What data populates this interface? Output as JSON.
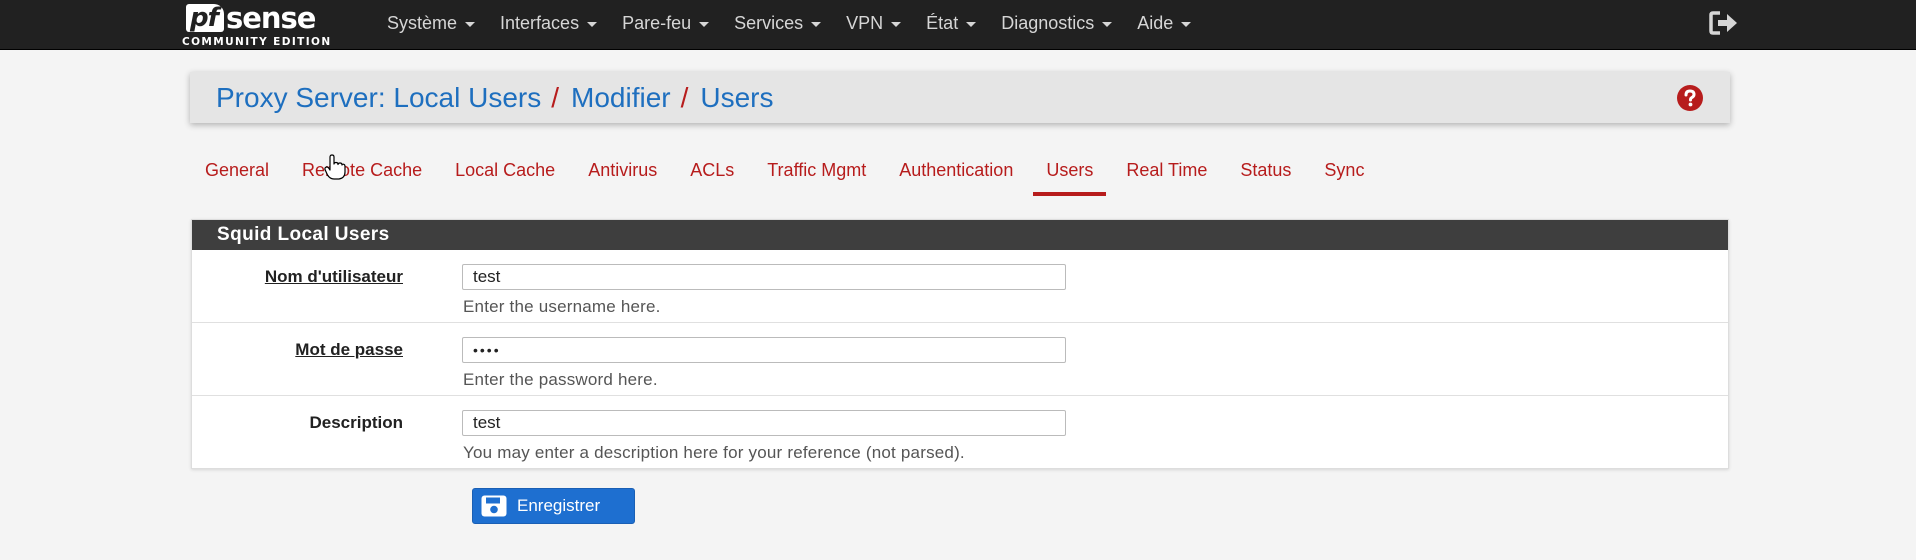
{
  "brand": {
    "logo_prefix": "pf",
    "logo_name": "sense",
    "edition": "COMMUNITY EDITION"
  },
  "nav": {
    "items": [
      {
        "label": "Système",
        "name": "nav-systeme"
      },
      {
        "label": "Interfaces",
        "name": "nav-interfaces"
      },
      {
        "label": "Pare-feu",
        "name": "nav-pare-feu"
      },
      {
        "label": "Services",
        "name": "nav-services"
      },
      {
        "label": "VPN",
        "name": "nav-vpn"
      },
      {
        "label": "État",
        "name": "nav-etat"
      },
      {
        "label": "Diagnostics",
        "name": "nav-diagnostics"
      },
      {
        "label": "Aide",
        "name": "nav-aide"
      }
    ],
    "logout_icon": "sign-out-icon"
  },
  "breadcrumb": {
    "items": [
      "Proxy Server: Local Users",
      "Modifier",
      "Users"
    ],
    "separator": "/",
    "help_icon": "question-circle-icon"
  },
  "tabs": {
    "items": [
      "General",
      "Remote Cache",
      "Local Cache",
      "Antivirus",
      "ACLs",
      "Traffic Mgmt",
      "Authentication",
      "Users",
      "Real Time",
      "Status",
      "Sync"
    ],
    "active": "Users"
  },
  "panel": {
    "title": "Squid Local Users",
    "fields": [
      {
        "label": "Nom d'utilisateur",
        "value": "test",
        "help": "Enter the username here."
      },
      {
        "label": "Mot de passe",
        "value": "••••",
        "help": "Enter the password here."
      },
      {
        "label": "Description",
        "value": "test",
        "help": "You may enter a description here for your reference (not parsed)."
      }
    ]
  },
  "save_button": {
    "label": "Enregistrer",
    "icon": "save-icon"
  },
  "colors": {
    "navbar": "#212121",
    "link_blue": "#1e6fbf",
    "accent_red": "#b71c1c",
    "panel_heading": "#3e3e3e",
    "button_blue": "#1e6fd0"
  }
}
